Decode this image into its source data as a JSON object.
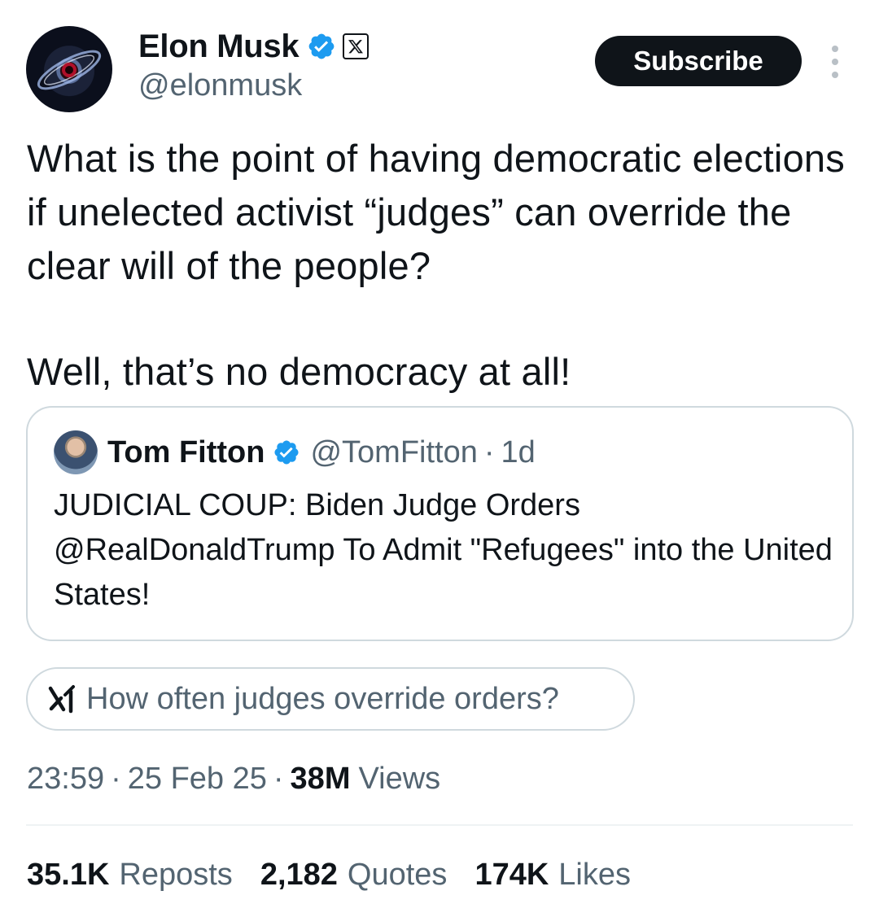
{
  "author": {
    "display_name": "Elon Musk",
    "handle": "@elonmusk",
    "verified": true,
    "affiliate_badge_icon": "x-logo-icon"
  },
  "actions": {
    "subscribe_label": "Subscribe",
    "more_icon": "more-vertical-icon"
  },
  "post": {
    "paragraph1": "What is the point of having democratic elections if unelected activist “judges” can override the clear will of the people?",
    "paragraph2": "Well, that’s no democracy at all!"
  },
  "quote": {
    "display_name": "Tom Fitton",
    "handle": "@TomFitton",
    "separator": "·",
    "age": "1d",
    "text": "JUDICIAL COUP: Biden Judge Orders @RealDonaldTrump To Admit \"Refugees\" into the United States!"
  },
  "grok": {
    "icon": "grok-icon",
    "prompt": "How often judges override orders?"
  },
  "meta": {
    "time": "23:59",
    "date": "25 Feb 25",
    "views_count": "38M",
    "views_label": "Views",
    "separator": "·"
  },
  "stats": [
    {
      "count": "35.1K",
      "label": "Reposts"
    },
    {
      "count": "2,182",
      "label": "Quotes"
    },
    {
      "count": "174K",
      "label": "Likes"
    }
  ],
  "colors": {
    "primary_text": "#0f1419",
    "secondary_text": "#536471",
    "verified_blue": "#1d9bf0",
    "border": "#cfd9de",
    "button_bg": "#0f1419"
  }
}
